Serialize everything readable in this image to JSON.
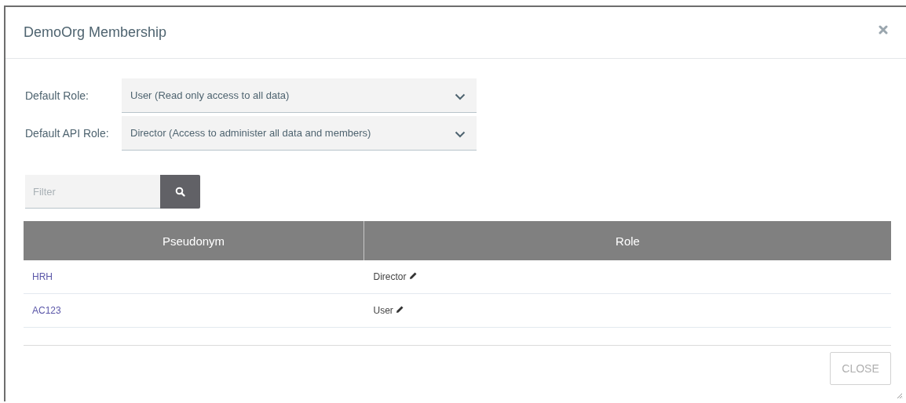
{
  "dialog": {
    "title": "DemoOrg Membership"
  },
  "settings": [
    {
      "label": "Default Role:",
      "value": "User (Read only access to all data)"
    },
    {
      "label": "Default API Role:",
      "value": "Director (Access to administer all data and members)"
    }
  ],
  "filter": {
    "placeholder": "Filter"
  },
  "table": {
    "columns": [
      "Pseudonym",
      "Role"
    ],
    "rows": [
      {
        "pseudonym": "HRH",
        "role": "Director"
      },
      {
        "pseudonym": "AC123",
        "role": "User"
      }
    ]
  },
  "buttons": [
    "CLOSE"
  ]
}
